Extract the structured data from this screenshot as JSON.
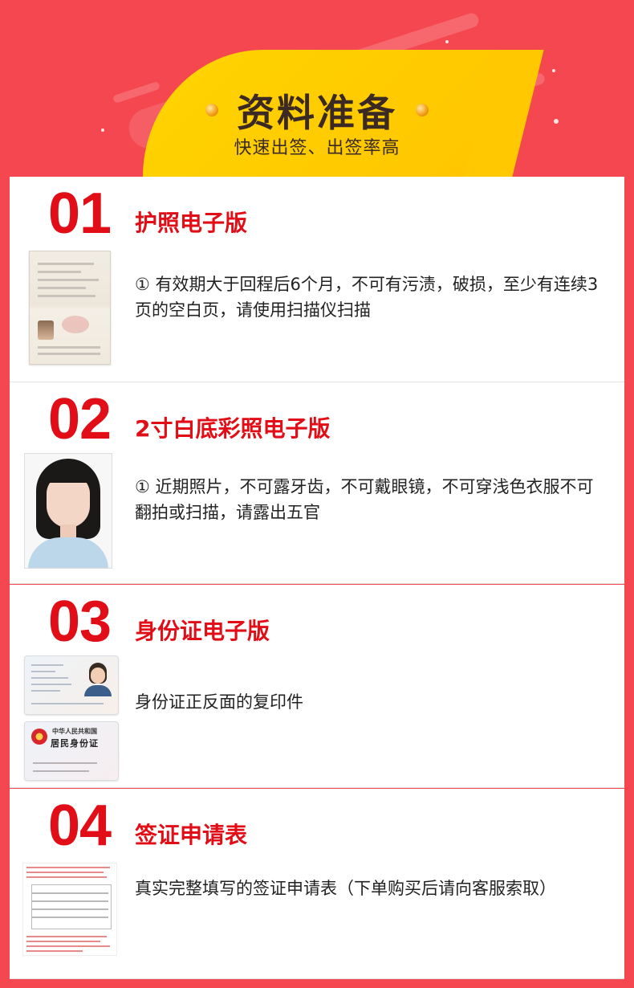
{
  "header": {
    "title": "资料准备",
    "subtitle": "快速出签、出签率高"
  },
  "items": [
    {
      "number": "01",
      "heading": "护照电子版",
      "description": "① 有效期大于回程后6个月，不可有污渍，破损，至少有连续3页的空白页，请使用扫描仪扫描",
      "thumbnail": "passport-scan-image"
    },
    {
      "number": "02",
      "heading": "2寸白底彩照电子版",
      "description": "① 近期照片，不可露牙齿，不可戴眼镜，不可穿浅色衣服不可翻拍或扫描，请露出五官",
      "thumbnail": "portrait-photo-image"
    },
    {
      "number": "03",
      "heading": "身份证电子版",
      "description": "身份证正反面的复印件",
      "thumbnail": "id-card-images",
      "id_back_text": [
        "中华人民共和国",
        "居民身份证"
      ]
    },
    {
      "number": "04",
      "heading": "签证申请表",
      "description": "真实完整填写的签证申请表（下单购买后请向客服索取）",
      "thumbnail": "visa-application-form-image"
    }
  ],
  "colors": {
    "background": "#f4474f",
    "banner": "#ffcc00",
    "accent_red": "#e10e17",
    "title_text": "#3a2a23"
  }
}
